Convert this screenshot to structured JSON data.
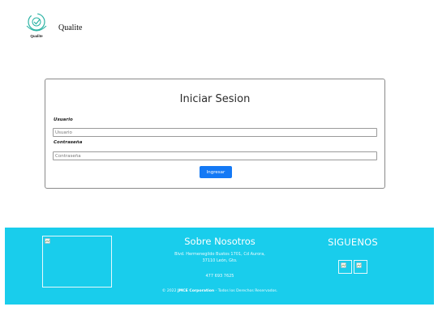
{
  "header": {
    "logo_text": "Qualite",
    "brand": "Qualite"
  },
  "login": {
    "title": "Iniciar Sesion",
    "user_label": "Usuario",
    "user_placeholder": "Usuario",
    "password_label": "Contraseña",
    "password_placeholder": "Contraseña",
    "submit_label": "Ingresar"
  },
  "footer": {
    "about_title": "Sobre Nosotros",
    "address_line1": "Blvd. Hermenegildo Bustos 1701, Cd Aurora,",
    "address_line2": "37110 León, Gto.",
    "phone": "477 693 7625",
    "copyright_prefix": "© 2022 ",
    "copyright_company": "JMCE Corporation",
    "copyright_suffix": " - Todos los Derechos Reservados.",
    "follow_title": "SIGUENOS"
  },
  "colors": {
    "footer_bg": "#19cdec",
    "button_bg": "#1479f5",
    "logo_teal": "#2bb3a4"
  },
  "icons": {
    "logo": "qualite-logo-icon",
    "broken_image": "broken-image-icon"
  }
}
